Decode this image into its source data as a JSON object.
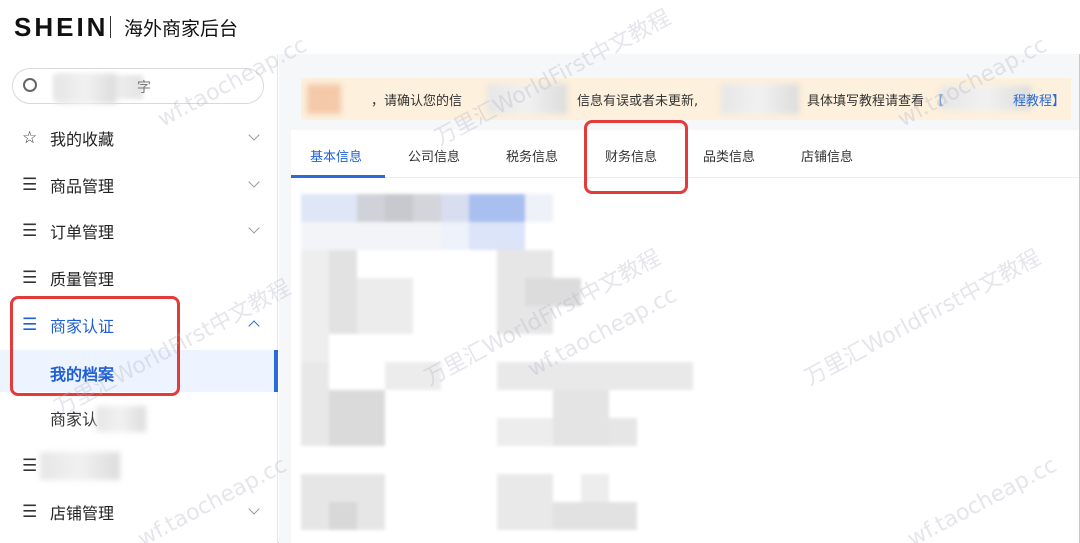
{
  "header": {
    "brand": "SHEIN",
    "title": "海外商家后台"
  },
  "sidebar": {
    "search": {
      "placeholder_tail": "字"
    },
    "items": [
      {
        "label": "我的收藏",
        "icon": "star-icon"
      },
      {
        "label": "商品管理",
        "icon": "menu-list-icon"
      },
      {
        "label": "订单管理",
        "icon": "menu-list-icon"
      },
      {
        "label": "质量管理",
        "icon": "menu-list-icon"
      },
      {
        "label": "商家认证",
        "icon": "menu-list-icon",
        "expanded": true
      },
      {
        "label": "店铺管理",
        "icon": "menu-list-icon"
      }
    ],
    "subitems": [
      {
        "label": "我的档案",
        "active": true
      },
      {
        "label": "商家认"
      }
    ]
  },
  "notice": {
    "part1": "，请确认您的信",
    "part2": "信息有误或者未更新,",
    "part3": "具体填写教程请查看",
    "link_open": "【",
    "link_tail": "程教程】"
  },
  "tabs": [
    {
      "label": "基本信息",
      "active": true
    },
    {
      "label": "公司信息"
    },
    {
      "label": "税务信息"
    },
    {
      "label": "财务信息"
    },
    {
      "label": "品类信息"
    },
    {
      "label": "店铺信息"
    }
  ],
  "watermark": {
    "text1": "万里汇WorldFirst中文教程",
    "text2": "wf.taocheap.cc"
  },
  "colors": {
    "accent": "#2a6ad9",
    "highlight": "#e43a3a",
    "notice_bg": "#fdf0dc"
  }
}
